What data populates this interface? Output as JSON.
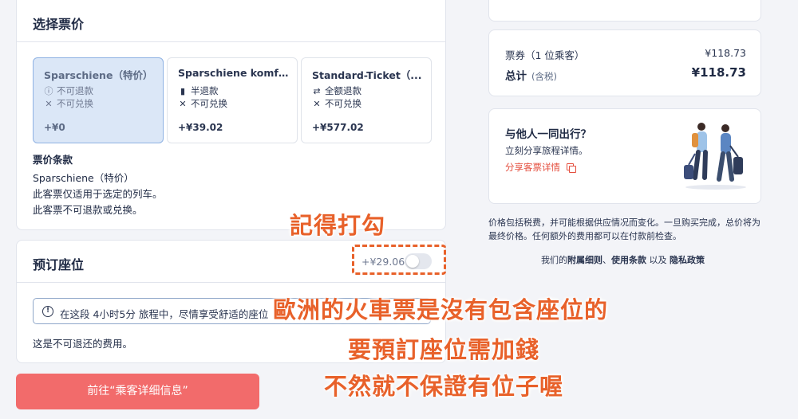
{
  "fare_section": {
    "title": "选择票价",
    "options": [
      {
        "name": "Sparschiene（特价）",
        "line1_icon": "ⓘ",
        "line1": "不可退款",
        "line2_icon": "✕",
        "line2": "不可兑换",
        "price": "+¥0",
        "selected": true
      },
      {
        "name": "Sparschiene komfort",
        "line1_icon": "▮",
        "line1": "半退款",
        "line2_icon": "✕",
        "line2": "不可兑换",
        "price": "+¥39.02",
        "selected": false
      },
      {
        "name": "Standard-Ticket（...",
        "line1_icon": "⇄",
        "line1": "全额退款",
        "line2_icon": "✕",
        "line2": "不可兑换",
        "price": "+¥577.02",
        "selected": false
      }
    ],
    "terms_title": "票价条款",
    "terms_lines": [
      "Sparschiene（特价）",
      "此客票仅适用于选定的列车。",
      "此客票不可退款或兑换。"
    ]
  },
  "seat_section": {
    "title": "预订座位",
    "price": "+¥29.06",
    "toggle_on": false,
    "info": "在这段 4小时5分 旅程中，尽情享受舒适的座位",
    "note": "这是不可退还的费用。"
  },
  "continue_button": "前往“乘客详细信息”",
  "summary": {
    "top_stub": "",
    "ticket_label": "票券（1 位乘客）",
    "ticket_value": "¥118.73",
    "total_label": "总计",
    "total_note": "(含税)",
    "total_value": "¥118.73"
  },
  "share": {
    "title": "与他人一同出行？",
    "subtitle": "立刻分享旅程详情。",
    "link": "分享客票详情"
  },
  "disclaimer": "价格包括税费，并可能根据供应情况而变化。一旦购买完成，总价将为最终价格。任何额外的费用都可以在付款前检查。",
  "policy": {
    "prefix": "我们的",
    "link1": "附属细则",
    "sep1": "、",
    "link2": "使用条款",
    "sep2": " 以及 ",
    "link3": "隐私政策"
  },
  "annotations": {
    "check": "記得打勾",
    "line1": "歐洲的火車票是沒有包含座位的",
    "line2": "要預訂座位需加錢",
    "line3": "不然就不保證有位子喔"
  },
  "colors": {
    "accent_red": "#f26b6b",
    "annotation_orange": "#e8612a",
    "selected_fare_bg": "#dbe7f7",
    "link_red": "#e44e3e"
  }
}
